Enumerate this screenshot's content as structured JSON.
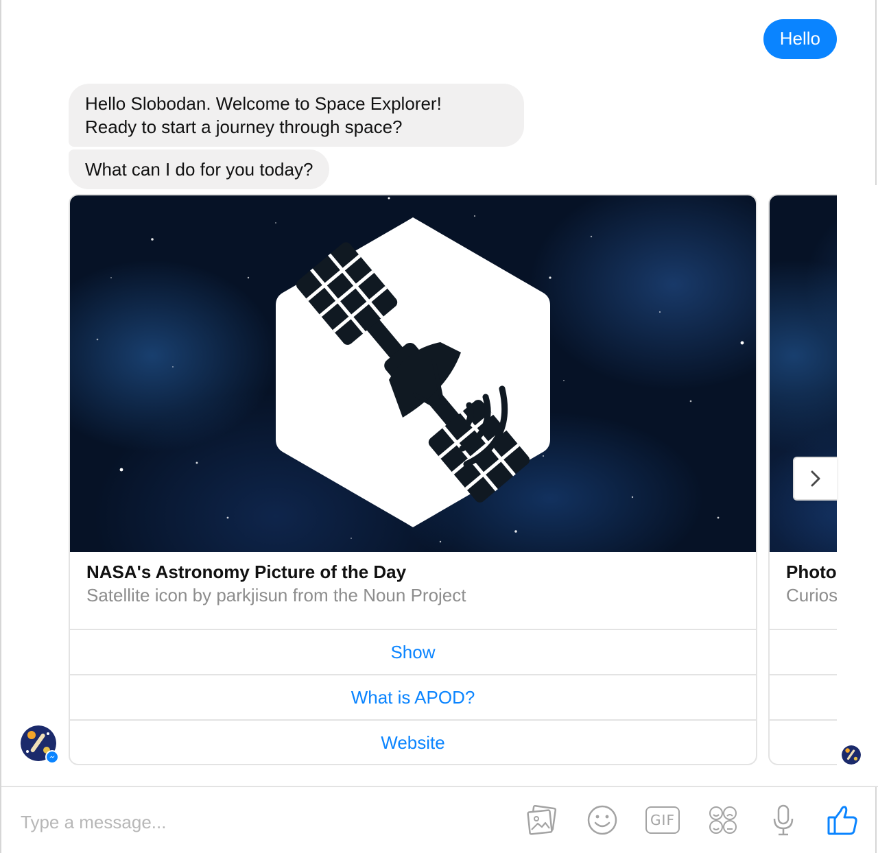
{
  "messages": {
    "outgoing": "Hello",
    "incoming_1_line1": "Hello Slobodan. Welcome to Space Explorer!",
    "incoming_1_line2": "Ready to start a journey through space?",
    "incoming_2": "What can I do for you today?"
  },
  "cards": [
    {
      "title": "NASA's Astronomy Picture of the Day",
      "subtitle": "Satellite icon by parkjisun from the Noun Project",
      "buttons": [
        "Show",
        "What is APOD?",
        "Website"
      ]
    },
    {
      "title": "Photo",
      "subtitle": "Curios"
    }
  ],
  "composer": {
    "placeholder": "Type a message..."
  },
  "toolbar": {
    "gif_label": "GIF"
  },
  "colors": {
    "accent": "#0a84ff",
    "incoming_bubble": "#f1f0f0",
    "space_bg": "#061226"
  }
}
